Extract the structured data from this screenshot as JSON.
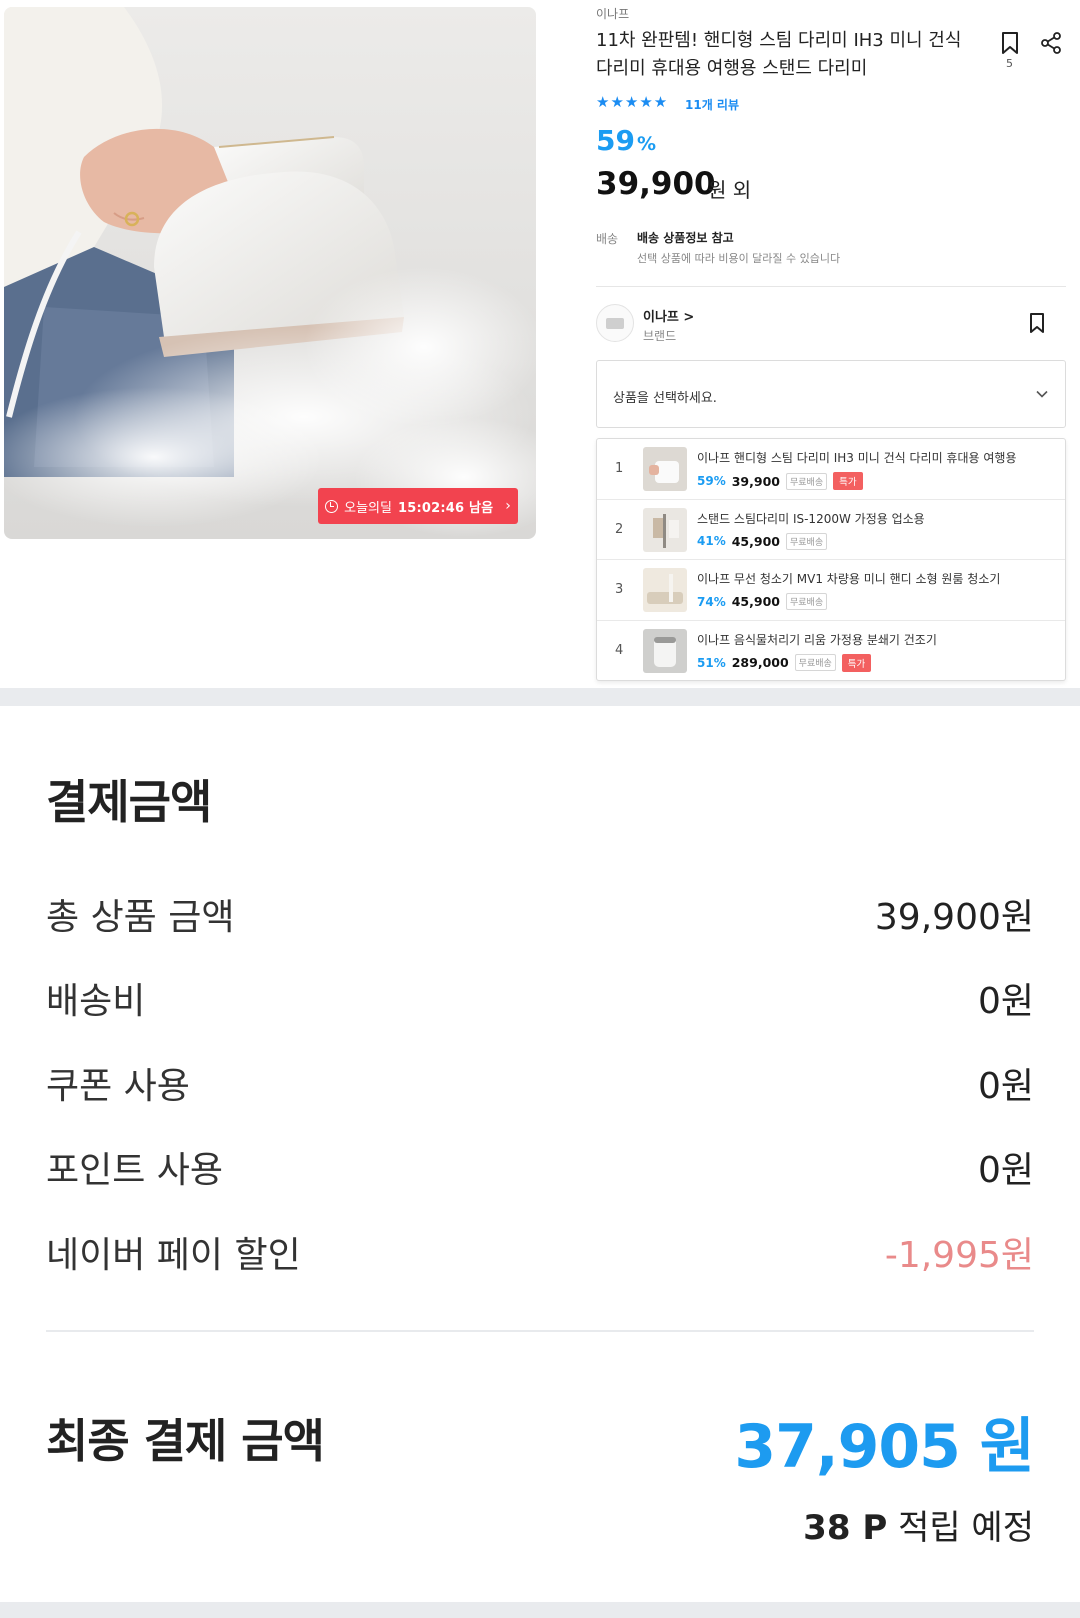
{
  "product": {
    "brand_small": "이나프",
    "title": "11차 완판템! 핸디형 스팀 다리미 IH3 미니 건식 다리미 휴대용 여행용 스탠드 다리미",
    "bookmark_count": "5",
    "stars": "★★★★★",
    "reviews": "11개 리뷰",
    "discount": "59",
    "discount_unit": "%",
    "price": "39,900",
    "price_unit": "원 외",
    "shipping_label": "배송",
    "shipping_value": "배송 상품정보 참고",
    "shipping_note": "선택 상품에 따라 비용이 달라질 수 있습니다",
    "timer": {
      "label": "오늘의딜",
      "time": "15:02:46 남음",
      "chevron": "›"
    }
  },
  "brand": {
    "name": "이나프 >",
    "sub": "브랜드"
  },
  "select": {
    "placeholder": "상품을 선택하세요."
  },
  "options": [
    {
      "index": "1",
      "name": "이나프 핸디형 스팀 다리미 IH3 미니 건식 다리미 휴대용 여행용",
      "discount": "59%",
      "price": "39,900",
      "free": "무료배송",
      "deal": "특가"
    },
    {
      "index": "2",
      "name": "스탠드 스팀다리미 IS-1200W 가정용 업소용",
      "discount": "41%",
      "price": "45,900",
      "free": "무료배송",
      "deal": ""
    },
    {
      "index": "3",
      "name": "이나프 무선 청소기 MV1 차량용 미니 핸디 소형 원룸 청소기",
      "discount": "74%",
      "price": "45,900",
      "free": "무료배송",
      "deal": ""
    },
    {
      "index": "4",
      "name": "이나프 음식물처리기 리움 가정용 분쇄기 건조기",
      "discount": "51%",
      "price": "289,000",
      "free": "무료배송",
      "deal": "특가"
    }
  ],
  "payment": {
    "title": "결제금액",
    "rows": [
      {
        "label": "총 상품 금액",
        "value": "39,900원"
      },
      {
        "label": "배송비",
        "value": "0원"
      },
      {
        "label": "쿠폰 사용",
        "value": "0원"
      },
      {
        "label": "포인트 사용",
        "value": "0원"
      },
      {
        "label": "네이버 페이 할인",
        "value": "-1,995원"
      }
    ],
    "final_label": "최종 결제 금액",
    "final_value": "37,905 원",
    "points_amount": "38 P",
    "points_text": "적립 예정"
  },
  "colors": {
    "accent": "#1d9bf0",
    "deal_red": "#f2434f",
    "discount_negative": "#e98a8a"
  },
  "icons": [
    "clock-icon",
    "chevron-right-icon",
    "bookmark-icon",
    "share-icon",
    "star-icon",
    "chevron-down-icon",
    "brand-logo-icon"
  ]
}
